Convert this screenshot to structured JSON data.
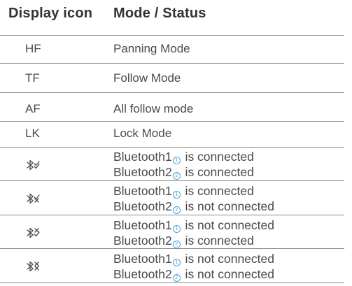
{
  "header": {
    "col1": "Display icon",
    "col2": "Mode / Status"
  },
  "rows": [
    {
      "icon_text": "HF",
      "mode": "Panning Mode"
    },
    {
      "icon_text": "TF",
      "mode": "Follow Mode"
    },
    {
      "icon_text": "AF",
      "mode": "All follow mode"
    },
    {
      "icon_text": "LK",
      "mode": "Lock Mode"
    }
  ],
  "bt_rows": [
    {
      "icon": "bluetooth-both-connected-icon",
      "line1_prefix": "Bluetooth1",
      "line1_badge": "1",
      "line1_status": " is connected",
      "line2_prefix": "Bluetooth2",
      "line2_badge": "2",
      "line2_status": " is connected"
    },
    {
      "icon": "bluetooth-2-disconnected-icon",
      "line1_prefix": "Bluetooth1",
      "line1_badge": "1",
      "line1_status": " is connected",
      "line2_prefix": "Bluetooth2",
      "line2_badge": "2",
      "line2_status": " is not connected"
    },
    {
      "icon": "bluetooth-1-disconnected-icon",
      "line1_prefix": "Bluetooth1",
      "line1_badge": "1",
      "line1_status": " is not connected",
      "line2_prefix": "Bluetooth2",
      "line2_badge": "2",
      "line2_status": " is connected"
    },
    {
      "icon": "bluetooth-none-connected-icon",
      "line1_prefix": "Bluetooth1",
      "line1_badge": "1",
      "line1_status": " is not connected",
      "line2_prefix": "Bluetooth2",
      "line2_badge": "2",
      "line2_status": " is not connected"
    }
  ],
  "colors": {
    "text": "#4a4a4a",
    "rule": "#8a8a8a",
    "badge": "#4aa0d8"
  }
}
